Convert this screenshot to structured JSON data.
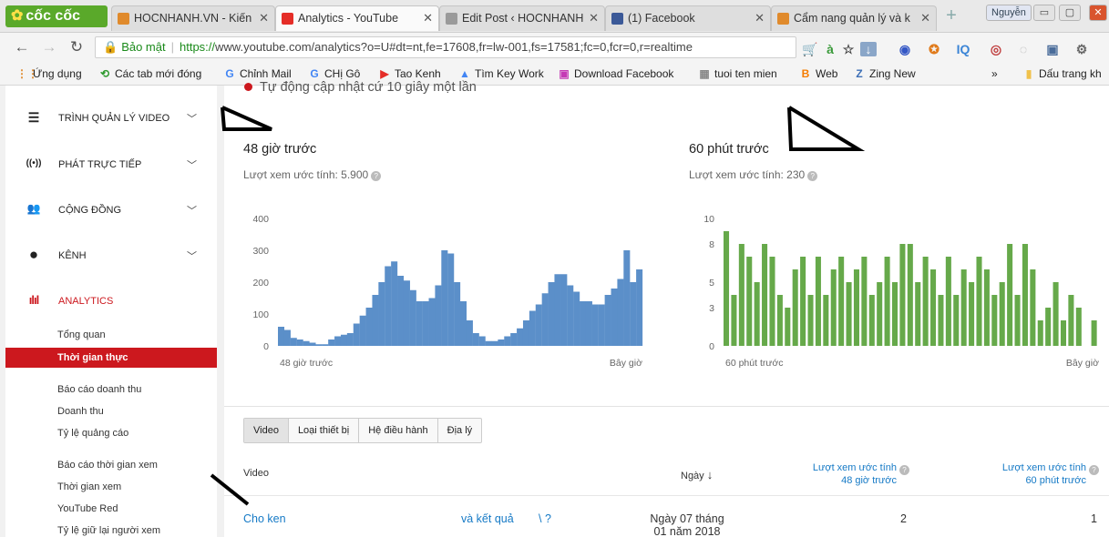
{
  "browser": {
    "brand": "cốc cốc",
    "tabs": [
      {
        "title": "HOCNHANH.VN - Kiến",
        "icon_color": "#e08a2c",
        "active": false
      },
      {
        "title": "Analytics - YouTube",
        "icon_color": "#e52d27",
        "active": true
      },
      {
        "title": "Edit Post ‹ HOCNHANH",
        "icon_color": "#9a9a9a",
        "active": false
      },
      {
        "title": "(1) Facebook",
        "icon_color": "#3b5998",
        "active": false
      },
      {
        "title": "Cẩm nang quản lý và k",
        "icon_color": "#e08a2c",
        "active": false
      }
    ],
    "profile": "Nguyễn",
    "address": {
      "security_label": "Bảo mật",
      "scheme": "https://",
      "url_rest": "www.youtube.com/analytics?o=U#dt=nt,fe=17608,fr=lw-001,fs=17581;fc=0,fcr=0,r=realtime"
    },
    "bookmarks": [
      {
        "label": "Ứng dụng",
        "icon": "apps-icon",
        "color": "#e08a2c"
      },
      {
        "label": "Các tab mới đóng",
        "icon": "history-icon",
        "color": "#2e9a2e"
      },
      {
        "label": "Chỉnh Mail",
        "icon": "google-icon",
        "color": "#4285f4"
      },
      {
        "label": "CHị Gô",
        "icon": "google-icon",
        "color": "#4285f4"
      },
      {
        "label": "Tao Kenh",
        "icon": "youtube-icon",
        "color": "#e52d27"
      },
      {
        "label": "Tìm Key Work",
        "icon": "ads-icon",
        "color": "#4285f4"
      },
      {
        "label": "Download Facebook",
        "icon": "download-icon",
        "color": "#c53ab5"
      },
      {
        "label": "tuoi ten mien",
        "icon": "domain-icon",
        "color": "#888888"
      },
      {
        "label": "Web",
        "icon": "blogger-icon",
        "color": "#f57c00"
      },
      {
        "label": "Zing New",
        "icon": "zing-icon",
        "color": "#3d6fb6"
      },
      {
        "label": "»",
        "icon": "more-icon",
        "color": "#555555"
      },
      {
        "label": "Dấu trang kh",
        "icon": "folder-icon",
        "color": "#f0c14b"
      }
    ]
  },
  "sidebar": {
    "sections": [
      {
        "label": "TRÌNH QUẢN LÝ VIDEO",
        "icon": "video-manager-icon",
        "glyph": "☰"
      },
      {
        "label": "PHÁT TRỰC TIẾP",
        "icon": "live-broadcast-icon",
        "glyph": "((•))"
      },
      {
        "label": "CỘNG ĐỒNG",
        "icon": "community-icon",
        "glyph": "👥"
      },
      {
        "label": "KÊNH",
        "icon": "channel-icon",
        "glyph": "●"
      },
      {
        "label": "ANALYTICS",
        "icon": "analytics-icon",
        "glyph": "ılıl"
      }
    ],
    "analytics_items": [
      "Tổng quan",
      "Thời gian thực",
      "Báo cáo doanh thu",
      "Doanh thu",
      "Tỷ lệ quảng cáo",
      "Báo cáo thời gian xem",
      "Thời gian xem",
      "YouTube Red",
      "Tỷ lệ giữ lại người xem"
    ],
    "active_item": "Thời gian thực"
  },
  "main": {
    "auto_update": "Tự động cập nhật cứ 10 giây một lần",
    "panels": [
      {
        "title": "48 giờ trước",
        "subtitle": "Lượt xem ước tính: 5.900"
      },
      {
        "title": "60 phút trước",
        "subtitle": "Lượt xem ước tính: 230"
      }
    ],
    "tabs": [
      "Video",
      "Loại thiết bị",
      "Hệ điều hành",
      "Địa lý"
    ],
    "table": {
      "headers": {
        "video": "Video",
        "date": "Ngày",
        "views48_line1": "Lượt xem ước tính",
        "views48_line2": "48 giờ trước",
        "views60_line1": "Lượt xem ước tính",
        "views60_line2": "60 phút trước"
      },
      "rows": [
        {
          "title_start": "Cho ken",
          "title_end": "và kết quả",
          "title_tail": "​i ?",
          "date_line1": "Ngày 07 tháng",
          "date_line2": "01 năm 2018",
          "views48": "2",
          "views60": "1"
        }
      ]
    }
  },
  "chart_data": [
    {
      "type": "bar",
      "color": "#5b8fc9",
      "x_start_label": "48 giờ trước",
      "x_end_label": "Bây giờ",
      "yticks": [
        0,
        100,
        200,
        300,
        400
      ],
      "ylim": [
        0,
        400
      ],
      "grid": false,
      "values": [
        60,
        50,
        25,
        20,
        15,
        10,
        5,
        5,
        20,
        30,
        35,
        40,
        70,
        95,
        120,
        160,
        200,
        250,
        265,
        220,
        205,
        175,
        140,
        140,
        150,
        190,
        300,
        290,
        200,
        140,
        80,
        40,
        30,
        15,
        15,
        20,
        30,
        40,
        55,
        80,
        110,
        130,
        165,
        200,
        225,
        225,
        190,
        170,
        140,
        140,
        130,
        130,
        160,
        180,
        210,
        300,
        200,
        240
      ]
    },
    {
      "type": "bar",
      "color": "#66a94a",
      "x_start_label": "60 phút trước",
      "x_end_label": "Bây giờ",
      "yticks": [
        0,
        3,
        5,
        8,
        10
      ],
      "ylim": [
        0,
        10
      ],
      "grid": false,
      "values": [
        9,
        4,
        8,
        7,
        5,
        8,
        7,
        4,
        3,
        6,
        7,
        4,
        7,
        4,
        6,
        7,
        5,
        6,
        7,
        4,
        5,
        7,
        5,
        8,
        8,
        5,
        7,
        6,
        4,
        7,
        4,
        6,
        5,
        7,
        6,
        4,
        5,
        8,
        4,
        8,
        6,
        2,
        3,
        5,
        2,
        4,
        3,
        0,
        2
      ]
    }
  ]
}
